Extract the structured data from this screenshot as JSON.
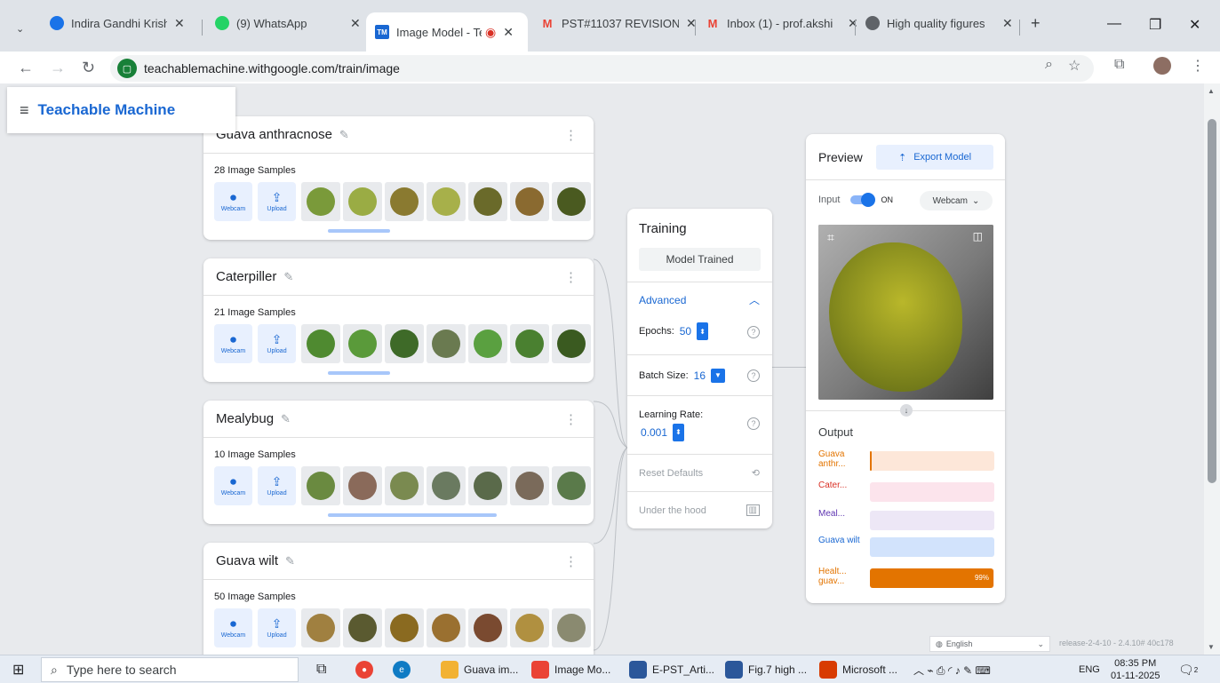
{
  "browser": {
    "tabs": [
      {
        "title": "Indira Gandhi Krishi V",
        "color": "#1a73e8",
        "glyph": "◉"
      },
      {
        "title": "(9) WhatsApp",
        "color": "#25d366",
        "glyph": "●"
      },
      {
        "title": "Image Model - Te",
        "color": "#1967d2",
        "glyph": "TM"
      },
      {
        "title": "PST#11037 REVISION",
        "color": "#ea4335",
        "glyph": "M"
      },
      {
        "title": "Inbox (1) - prof.akshi",
        "color": "#ea4335",
        "glyph": "M"
      },
      {
        "title": "High quality figures",
        "color": "#5f6368",
        "glyph": "◎"
      }
    ],
    "new_tab": "+",
    "url": "teachablemachine.withgoogle.com/train/image"
  },
  "app": {
    "brand": "Teachable Machine"
  },
  "classes": [
    {
      "name": "Guava anthracnose",
      "count": "28 Image Samples",
      "thumbs": [
        "#7a9a3a",
        "#9aac44",
        "#8a7a30",
        "#a7b04a",
        "#6a6a2a",
        "#8a6a30",
        "#4a5a20"
      ]
    },
    {
      "name": "Caterpiller",
      "count": "21 Image Samples",
      "thumbs": [
        "#4f8a30",
        "#5a9a3a",
        "#3e6a28",
        "#6a7a50",
        "#5aa040",
        "#4a8030",
        "#3a5a20"
      ]
    },
    {
      "name": "Mealybug",
      "count": "10 Image Samples",
      "thumbs": [
        "#6a8a40",
        "#8a6a5a",
        "#7a8a50",
        "#6a7a60",
        "#5a6a4a",
        "#7a6a5a",
        "#5a7a4a"
      ]
    },
    {
      "name": "Guava wilt",
      "count": "50 Image Samples",
      "thumbs": [
        "#a08040",
        "#5a5a30",
        "#8a6a20",
        "#9a7030",
        "#7a4a30",
        "#b09040",
        "#8a8a70"
      ]
    }
  ],
  "source_buttons": {
    "webcam": "Webcam",
    "upload": "Upload"
  },
  "training": {
    "title": "Training",
    "button": "Model Trained",
    "advanced": "Advanced",
    "epochs_label": "Epochs:",
    "epochs_value": "50",
    "batch_label": "Batch Size:",
    "batch_value": "16",
    "lr_label": "Learning Rate:",
    "lr_value": "0.001",
    "reset": "Reset Defaults",
    "under_hood": "Under the hood"
  },
  "preview": {
    "title": "Preview",
    "export": "Export Model",
    "input_label": "Input",
    "toggle_state": "ON",
    "source": "Webcam",
    "output_title": "Output",
    "outputs": [
      {
        "label": "Guava anthr...",
        "color": "#e37400",
        "bg": "#fde7d9",
        "value": 0.01,
        "pct": ""
      },
      {
        "label": "Cater...",
        "color": "#d93025",
        "bg": "#fce4ec",
        "value": 0,
        "pct": ""
      },
      {
        "label": "Meal...",
        "color": "#5e35b1",
        "bg": "#ede7f6",
        "value": 0,
        "pct": ""
      },
      {
        "label": "Guava wilt",
        "color": "#1967d2",
        "bg": "#d2e3fc",
        "value": 0,
        "pct": ""
      },
      {
        "label": "Healt... guav...",
        "color": "#e37400",
        "bg": "#fde7d9",
        "value": 0.99,
        "pct": "99%"
      }
    ]
  },
  "footer": {
    "language": "English",
    "release": "release-2-4-10 - 2.4.10# 40c178"
  },
  "taskbar": {
    "search_placeholder": "Type here to search",
    "apps": [
      {
        "label": "Guava im...",
        "color": "#f2b233"
      },
      {
        "label": "Image Mo...",
        "color": "#ea4335"
      },
      {
        "label": "E-PST_Arti...",
        "color": "#2b579a"
      },
      {
        "label": "Fig.7 high ...",
        "color": "#2b579a"
      },
      {
        "label": "Microsoft ...",
        "color": "#d83b01"
      }
    ],
    "lang": "ENG",
    "time": "08:35 PM",
    "date": "01-11-2025",
    "notif": "2"
  }
}
